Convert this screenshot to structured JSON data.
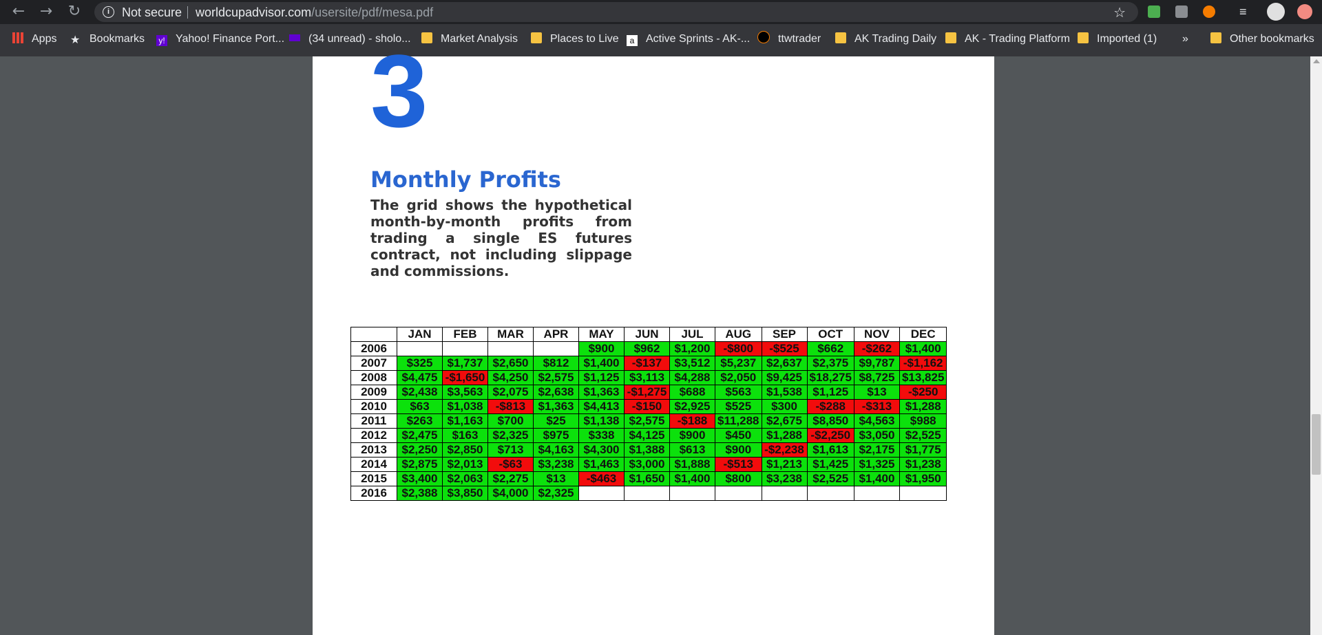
{
  "browser": {
    "security_label": "Not secure",
    "url_host": "worldcupadvisor.com",
    "url_path": "/usersite/pdf/mesa.pdf"
  },
  "bookmarks": [
    {
      "label": "Apps",
      "icon": "apps-grid-icon"
    },
    {
      "label": "Bookmarks",
      "icon": "star-icon"
    },
    {
      "label": "Yahoo! Finance Port...",
      "icon": "yahoo-icon"
    },
    {
      "label": "(34 unread) - sholo...",
      "icon": "yahoo-mail-icon"
    },
    {
      "label": "Market Analysis",
      "icon": "folder-icon"
    },
    {
      "label": "Places to Live",
      "icon": "folder-icon"
    },
    {
      "label": "Active Sprints - AK-...",
      "icon": "atlassian-icon"
    },
    {
      "label": "ttwtrader",
      "icon": "rss-icon"
    },
    {
      "label": "AK Trading Daily",
      "icon": "folder-icon"
    },
    {
      "label": "AK - Trading Platform",
      "icon": "folder-icon"
    },
    {
      "label": "Imported (1)",
      "icon": "folder-icon"
    }
  ],
  "overflow_label": "»",
  "other_bookmarks": "Other bookmarks",
  "document": {
    "big_number": "3",
    "title": "Monthly Profits",
    "description": "The grid shows the hypothetical month-by-month profits from trading a single ES futures contract, not including slippage and commissions."
  },
  "grid": {
    "months": [
      "JAN",
      "FEB",
      "MAR",
      "APR",
      "MAY",
      "JUN",
      "JUL",
      "AUG",
      "SEP",
      "OCT",
      "NOV",
      "DEC"
    ],
    "rows": [
      {
        "year": "2006",
        "cells": [
          "",
          "",
          "",
          "",
          "$900",
          "$962",
          "$1,200",
          "-$800",
          "-$525",
          "$662",
          "-$262",
          "$1,400"
        ]
      },
      {
        "year": "2007",
        "cells": [
          "$325",
          "$1,737",
          "$2,650",
          "$812",
          "$1,400",
          "-$137",
          "$3,512",
          "$5,237",
          "$2,637",
          "$2,375",
          "$9,787",
          "-$1,162"
        ]
      },
      {
        "year": "2008",
        "cells": [
          "$4,475",
          "-$1,650",
          "$4,250",
          "$2,575",
          "$1,125",
          "$3,113",
          "$4,288",
          "$2,050",
          "$9,425",
          "$18,275",
          "$8,725",
          "$13,825"
        ]
      },
      {
        "year": "2009",
        "cells": [
          "$2,438",
          "$3,563",
          "$2,075",
          "$2,638",
          "$1,363",
          "-$1,275",
          "$688",
          "$563",
          "$1,538",
          "$1,125",
          "$13",
          "-$250"
        ]
      },
      {
        "year": "2010",
        "cells": [
          "$63",
          "$1,038",
          "-$813",
          "$1,363",
          "$4,413",
          "-$150",
          "$2,925",
          "$525",
          "$300",
          "-$288",
          "-$313",
          "$1,288"
        ]
      },
      {
        "year": "2011",
        "cells": [
          "$263",
          "$1,163",
          "$700",
          "$25",
          "$1,138",
          "$2,575",
          "-$188",
          "$11,288",
          "$2,675",
          "$8,850",
          "$4,563",
          "$988"
        ]
      },
      {
        "year": "2012",
        "cells": [
          "$2,475",
          "$163",
          "$2,325",
          "$975",
          "$338",
          "$4,125",
          "$900",
          "$450",
          "$1,288",
          "-$2,250",
          "$3,050",
          "$2,525"
        ]
      },
      {
        "year": "2013",
        "cells": [
          "$2,250",
          "$2,850",
          "$713",
          "$4,163",
          "$4,300",
          "$1,388",
          "$613",
          "$900",
          "-$2,238",
          "$1,613",
          "$2,175",
          "$1,775"
        ]
      },
      {
        "year": "2014",
        "cells": [
          "$2,875",
          "$2,013",
          "-$63",
          "$3,238",
          "$1,463",
          "$3,000",
          "$1,888",
          "-$513",
          "$1,213",
          "$1,425",
          "$1,325",
          "$1,238"
        ]
      },
      {
        "year": "2015",
        "cells": [
          "$3,400",
          "$2,063",
          "$2,275",
          "$13",
          "-$463",
          "$1,650",
          "$1,400",
          "$800",
          "$3,238",
          "$2,525",
          "$1,400",
          "$1,950"
        ]
      },
      {
        "year": "2016",
        "cells": [
          "$2,388",
          "$3,850",
          "$4,000",
          "$2,325",
          "",
          "",
          "",
          "",
          "",
          "",
          "",
          ""
        ]
      }
    ],
    "colors": {
      "positive": "#0ce10c",
      "negative": "#f20c0c"
    }
  }
}
